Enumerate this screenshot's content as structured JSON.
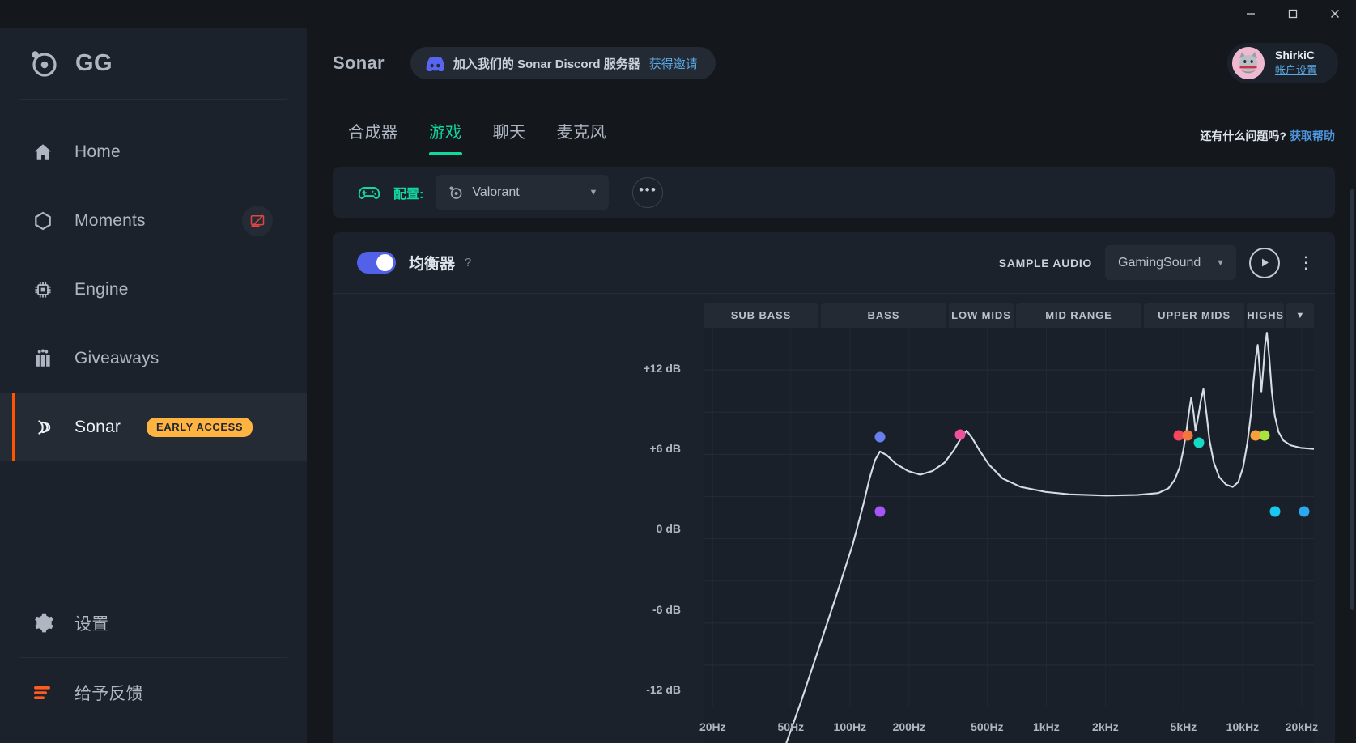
{
  "window": {
    "minimize": "minimize-icon",
    "maximize": "maximize-icon",
    "close": "close-icon"
  },
  "sidebar": {
    "brand": "GG",
    "items": [
      {
        "label": "Home",
        "icon": "home-icon"
      },
      {
        "label": "Moments",
        "icon": "hexagon-icon",
        "action_icon": "screen-off-icon"
      },
      {
        "label": "Engine",
        "icon": "cpu-icon"
      },
      {
        "label": "Giveaways",
        "icon": "gift-icon"
      },
      {
        "label": "Sonar",
        "icon": "sonar-icon",
        "badge": "EARLY ACCESS",
        "active": true
      }
    ],
    "bottom": [
      {
        "label": "设置",
        "icon": "gear-icon"
      },
      {
        "label": "给予反馈",
        "icon": "feedback-icon"
      }
    ]
  },
  "header": {
    "title": "Sonar",
    "discord": {
      "text": "加入我们的 Sonar Discord 服务器",
      "link": "获得邀请",
      "icon": "discord-icon"
    },
    "user": {
      "name": "ShirkiC",
      "link": "帐户设置"
    }
  },
  "tabs": [
    {
      "label": "合成器",
      "active": false
    },
    {
      "label": "游戏",
      "active": true
    },
    {
      "label": "聊天",
      "active": false
    },
    {
      "label": "麦克风",
      "active": false
    }
  ],
  "help": {
    "question": "还有什么问题吗?",
    "link": "获取帮助"
  },
  "config": {
    "label": "配置:",
    "selected": "Valorant",
    "more": "•••"
  },
  "equalizer": {
    "enabled": true,
    "title": "均衡器",
    "help": "?",
    "sample_audio_label": "SAMPLE AUDIO",
    "sample_audio_value": "GamingSound",
    "play": "play-icon",
    "menu": "kebab-icon"
  },
  "chart_data": {
    "type": "line",
    "title": "Equalizer response curve",
    "xlabel": "",
    "ylabel": "dB",
    "grid": true,
    "legend": "none",
    "bands": [
      "SUB BASS",
      "BASS",
      "LOW MIDS",
      "MID RANGE",
      "UPPER MIDS",
      "HIGHS"
    ],
    "band_widths": [
      186,
      203,
      105,
      203,
      163,
      172
    ],
    "ylim": [
      -16,
      15
    ],
    "yticks": [
      12,
      6,
      0,
      -6,
      -12
    ],
    "ytick_labels": [
      "+12 dB",
      "+6 dB",
      "0 dB",
      "-6 dB",
      "-12 dB"
    ],
    "xticks": [
      20,
      50,
      100,
      200,
      500,
      1000,
      2000,
      5000,
      10000,
      20000
    ],
    "xtick_labels": [
      "20Hz",
      "50Hz",
      "100Hz",
      "200Hz",
      "500Hz",
      "1kHz",
      "2kHz",
      "5kHz",
      "10kHz",
      "20kHz"
    ],
    "curve_color": "#d7dde4",
    "curve_points": [
      [
        0.135,
        -19.0
      ],
      [
        0.16,
        -15.5
      ],
      [
        0.19,
        -11.0
      ],
      [
        0.22,
        -6.5
      ],
      [
        0.245,
        -2.6
      ],
      [
        0.262,
        0.6
      ],
      [
        0.272,
        2.7
      ],
      [
        0.281,
        4.2
      ],
      [
        0.289,
        4.9
      ],
      [
        0.3,
        4.6
      ],
      [
        0.315,
        3.9
      ],
      [
        0.335,
        3.3
      ],
      [
        0.355,
        3.0
      ],
      [
        0.375,
        3.3
      ],
      [
        0.395,
        4.0
      ],
      [
        0.41,
        5.0
      ],
      [
        0.422,
        6.0
      ],
      [
        0.431,
        6.6
      ],
      [
        0.44,
        6.0
      ],
      [
        0.452,
        5.0
      ],
      [
        0.468,
        3.8
      ],
      [
        0.49,
        2.7
      ],
      [
        0.52,
        2.0
      ],
      [
        0.56,
        1.6
      ],
      [
        0.6,
        1.4
      ],
      [
        0.66,
        1.3
      ],
      [
        0.71,
        1.35
      ],
      [
        0.745,
        1.5
      ],
      [
        0.762,
        1.9
      ],
      [
        0.772,
        2.6
      ],
      [
        0.78,
        3.6
      ],
      [
        0.786,
        5.0
      ],
      [
        0.791,
        6.5
      ],
      [
        0.795,
        8.0
      ],
      [
        0.799,
        9.3
      ],
      [
        0.803,
        8.0
      ],
      [
        0.806,
        6.6
      ],
      [
        0.81,
        7.6
      ],
      [
        0.815,
        9.1
      ],
      [
        0.819,
        10.0
      ],
      [
        0.824,
        8.0
      ],
      [
        0.829,
        5.8
      ],
      [
        0.836,
        4.0
      ],
      [
        0.845,
        2.8
      ],
      [
        0.856,
        2.2
      ],
      [
        0.867,
        2.0
      ],
      [
        0.876,
        2.4
      ],
      [
        0.884,
        3.6
      ],
      [
        0.891,
        5.6
      ],
      [
        0.897,
        8.0
      ],
      [
        0.901,
        10.6
      ],
      [
        0.905,
        12.6
      ],
      [
        0.908,
        13.6
      ],
      [
        0.911,
        11.8
      ],
      [
        0.914,
        9.8
      ],
      [
        0.917,
        11.6
      ],
      [
        0.92,
        13.6
      ],
      [
        0.923,
        14.6
      ],
      [
        0.927,
        12.5
      ],
      [
        0.931,
        9.8
      ],
      [
        0.936,
        7.8
      ],
      [
        0.942,
        6.5
      ],
      [
        0.95,
        5.8
      ],
      [
        0.962,
        5.4
      ],
      [
        0.978,
        5.2
      ],
      [
        1.0,
        5.1
      ]
    ],
    "handles": [
      {
        "x": 0.289,
        "db": 6.1,
        "color": "#6b7ef0"
      },
      {
        "x": 0.289,
        "db": 0.0,
        "color": "#a855f7"
      },
      {
        "x": 0.421,
        "db": 6.3,
        "color": "#f0519a"
      },
      {
        "x": 0.778,
        "db": 6.2,
        "color": "#f5465a"
      },
      {
        "x": 0.793,
        "db": 6.2,
        "color": "#f3763f"
      },
      {
        "x": 0.812,
        "db": 5.6,
        "color": "#18d9c4"
      },
      {
        "x": 0.904,
        "db": 6.2,
        "color": "#f7a13a"
      },
      {
        "x": 0.919,
        "db": 6.2,
        "color": "#a9e33b"
      },
      {
        "x": 0.937,
        "db": 0.0,
        "color": "#19c8f0"
      },
      {
        "x": 0.984,
        "db": 0.0,
        "color": "#2ba8ef"
      }
    ]
  }
}
